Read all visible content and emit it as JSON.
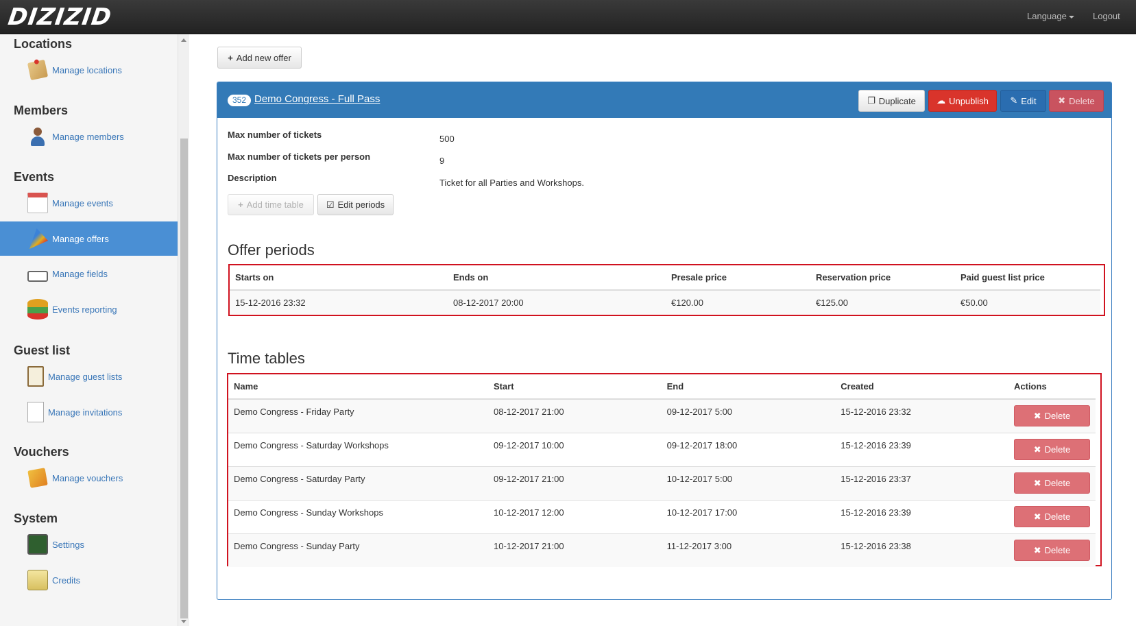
{
  "topbar": {
    "logo": "DIZIZID",
    "language_label": "Language",
    "logout_label": "Logout"
  },
  "sidebar": {
    "sections": [
      {
        "heading": "Locations",
        "items": [
          {
            "label": "Manage locations",
            "icon": "map-pin-icon"
          }
        ]
      },
      {
        "heading": "Members",
        "items": [
          {
            "label": "Manage members",
            "icon": "user-icon"
          }
        ]
      },
      {
        "heading": "Events",
        "items": [
          {
            "label": "Manage events",
            "icon": "calendar-icon"
          },
          {
            "label": "Manage offers",
            "icon": "offer-icon",
            "active": true
          },
          {
            "label": "Manage fields",
            "icon": "text-field-icon"
          },
          {
            "label": "Events reporting",
            "icon": "chart-icon"
          }
        ]
      },
      {
        "heading": "Guest list",
        "items": [
          {
            "label": "Manage guest lists",
            "icon": "clipboard-icon"
          },
          {
            "label": "Manage invitations",
            "icon": "checklist-icon"
          }
        ]
      },
      {
        "heading": "Vouchers",
        "items": [
          {
            "label": "Manage vouchers",
            "icon": "voucher-icon"
          }
        ]
      },
      {
        "heading": "System",
        "items": [
          {
            "label": "Settings",
            "icon": "settings-icon"
          },
          {
            "label": "Credits",
            "icon": "credits-icon"
          }
        ]
      }
    ]
  },
  "main": {
    "add_offer_label": "Add new offer",
    "offer": {
      "id": "352",
      "title": "Demo Congress - Full Pass",
      "actions": {
        "duplicate": "Duplicate",
        "unpublish": "Unpublish",
        "edit": "Edit",
        "delete": "Delete"
      },
      "details": [
        {
          "label": "Max number of tickets",
          "value": "500"
        },
        {
          "label": "Max number of tickets per person",
          "value": "9"
        },
        {
          "label": "Description",
          "value": "Ticket for all Parties and Workshops."
        }
      ],
      "add_time_table_label": "Add time table",
      "edit_periods_label": "Edit periods"
    },
    "offer_periods": {
      "title": "Offer periods",
      "columns": [
        "Starts on",
        "Ends on",
        "Presale price",
        "Reservation price",
        "Paid guest list price"
      ],
      "rows": [
        [
          "15-12-2016 23:32",
          "08-12-2017 20:00",
          "€120.00",
          "€125.00",
          "€50.00"
        ]
      ]
    },
    "time_tables": {
      "title": "Time tables",
      "columns": [
        "Name",
        "Start",
        "End",
        "Created",
        "Actions"
      ],
      "delete_label": "Delete",
      "rows": [
        [
          "Demo Congress - Friday Party",
          "08-12-2017 21:00",
          "09-12-2017 5:00",
          "15-12-2016 23:32"
        ],
        [
          "Demo Congress - Saturday Workshops",
          "09-12-2017 10:00",
          "09-12-2017 18:00",
          "15-12-2016 23:39"
        ],
        [
          "Demo Congress - Saturday Party",
          "09-12-2017 21:00",
          "10-12-2017 5:00",
          "15-12-2016 23:37"
        ],
        [
          "Demo Congress - Sunday Workshops",
          "10-12-2017 12:00",
          "10-12-2017 17:00",
          "15-12-2016 23:39"
        ],
        [
          "Demo Congress - Sunday Party",
          "10-12-2017 21:00",
          "11-12-2017 3:00",
          "15-12-2016 23:38"
        ]
      ]
    }
  }
}
